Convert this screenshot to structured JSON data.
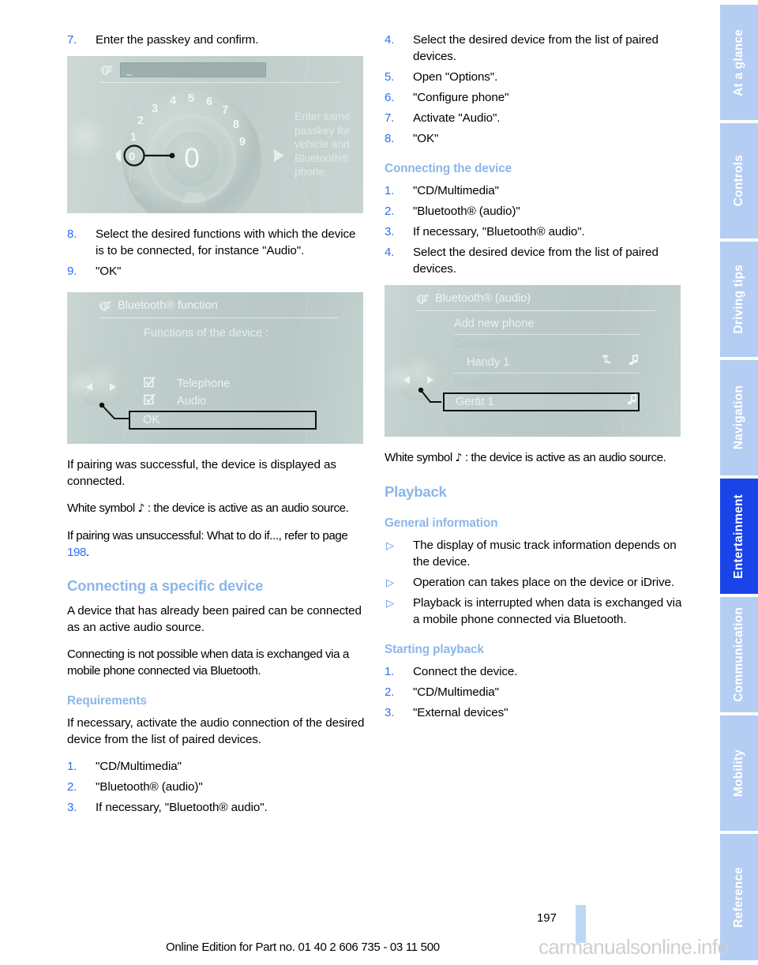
{
  "page_number": "197",
  "footer": {
    "edition": "Online Edition for Part no. 01 40 2 606 735 - 03 11 500",
    "watermark": "carmanualsonline.info"
  },
  "colors": {
    "heading_blue": "#8cb6e8",
    "number_blue": "#2a6df4",
    "tab_blue": "#b4cdf2",
    "tab_active_blue": "#1a43e8",
    "illustration_bg": "#c2d0ce"
  },
  "tabs": [
    {
      "label": "At a glance",
      "active": false
    },
    {
      "label": "Controls",
      "active": false
    },
    {
      "label": "Driving tips",
      "active": false
    },
    {
      "label": "Navigation",
      "active": false
    },
    {
      "label": "Entertainment",
      "active": true
    },
    {
      "label": "Communication",
      "active": false
    },
    {
      "label": "Mobility",
      "active": false
    },
    {
      "label": "Reference",
      "active": false
    }
  ],
  "left_column": {
    "step7": {
      "num": "7.",
      "text": "Enter the passkey and confirm."
    },
    "illustration_passkey": {
      "header_title": "",
      "input_value": "_",
      "hint_lines": [
        "Enter same",
        "passkey for",
        "vehicle and",
        "Bluetooth®",
        "phone."
      ],
      "dial_digits": [
        "0",
        "1",
        "2",
        "3",
        "4",
        "5",
        "6",
        "7",
        "8",
        "9"
      ],
      "center_value": "0",
      "back_label": "OK"
    },
    "step8": {
      "num": "8.",
      "text": "Select the desired functions with which the device is to be connected, for instance \"Audio\"."
    },
    "step9": {
      "num": "9.",
      "text": "\"OK\""
    },
    "illustration_functions": {
      "title": "Bluetooth® function",
      "subtitle": "Functions of the device :",
      "items": [
        {
          "label": "Telephone",
          "checked": true
        },
        {
          "label": "Audio",
          "checked": true
        }
      ],
      "ok_label": "OK"
    },
    "p_success": "If pairing was successful, the device is displayed as connected.",
    "p_white_symbol_a": "White symbol",
    "p_white_symbol_b": ": the device is active as an audio source.",
    "p_unsuccessful_a": "If pairing was unsuccessful: What to do if..., refer to page ",
    "p_unsuccessful_ref": "198",
    "p_unsuccessful_b": ".",
    "h_connecting_specific": "Connecting a specific device",
    "p_already_paired": "A device that has already been paired can be connected as an active audio source.",
    "p_not_possible": "Connecting is not possible when data is exchanged via a mobile phone connected via Bluetooth.",
    "h_requirements": "Requirements",
    "p_requirements": "If necessary, activate the audio connection of the desired device from the list of paired devices.",
    "requirements_steps": [
      {
        "num": "1.",
        "text": "\"CD/Multimedia\""
      },
      {
        "num": "2.",
        "text": "\"Bluetooth® (audio)\""
      },
      {
        "num": "3.",
        "text": "If necessary, \"Bluetooth® audio\"."
      }
    ]
  },
  "right_column": {
    "top_steps": [
      {
        "num": "4.",
        "text": "Select the desired device from the list of paired devices."
      },
      {
        "num": "5.",
        "text": "Open \"Options\"."
      },
      {
        "num": "6.",
        "text": "\"Configure phone\""
      },
      {
        "num": "7.",
        "text": "Activate \"Audio\"."
      },
      {
        "num": "8.",
        "text": "\"OK\""
      }
    ],
    "h_connecting_device": "Connecting the device",
    "connecting_steps": [
      {
        "num": "1.",
        "text": "\"CD/Multimedia\""
      },
      {
        "num": "2.",
        "text": "\"Bluetooth® (audio)\""
      },
      {
        "num": "3.",
        "text": "If necessary, \"Bluetooth® audio\"."
      },
      {
        "num": "4.",
        "text": "Select the desired device from the list of paired devices."
      }
    ],
    "illustration_bt_audio": {
      "title": "Bluetooth® (audio)",
      "add_new_phone": "Add new phone",
      "connected_label": "Connected:",
      "connected_device": "Handy 1",
      "paired_label": "Paired:",
      "paired_device": "Gerät 1"
    },
    "p_white_symbol_a": "White symbol",
    "p_white_symbol_b": ": the device is active as an audio source.",
    "h_playback": "Playback",
    "h_general_information": "General information",
    "general_bullets": [
      "The display of music track information depends on the device.",
      "Operation can takes place on the device or iDrive.",
      "Playback is interrupted when data is exchanged via a mobile phone connected via Bluetooth."
    ],
    "h_starting_playback": "Starting playback",
    "starting_steps": [
      {
        "num": "1.",
        "text": "Connect the device."
      },
      {
        "num": "2.",
        "text": "\"CD/Multimedia\""
      },
      {
        "num": "3.",
        "text": "\"External devices\""
      }
    ]
  }
}
